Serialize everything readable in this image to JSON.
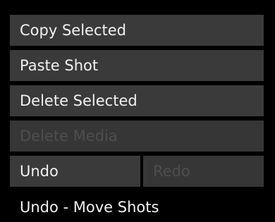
{
  "menu": {
    "copy_selected": "Copy Selected",
    "paste_shot": "Paste Shot",
    "delete_selected": "Delete Selected",
    "delete_media": "Delete Media",
    "undo": "Undo",
    "redo": "Redo"
  },
  "status": {
    "last_action": "Undo - Move Shots"
  },
  "colors": {
    "background": "#000000",
    "button": "#3a3a3a",
    "text": "#f2f2f2",
    "disabled_text": "#4e4e4e"
  }
}
